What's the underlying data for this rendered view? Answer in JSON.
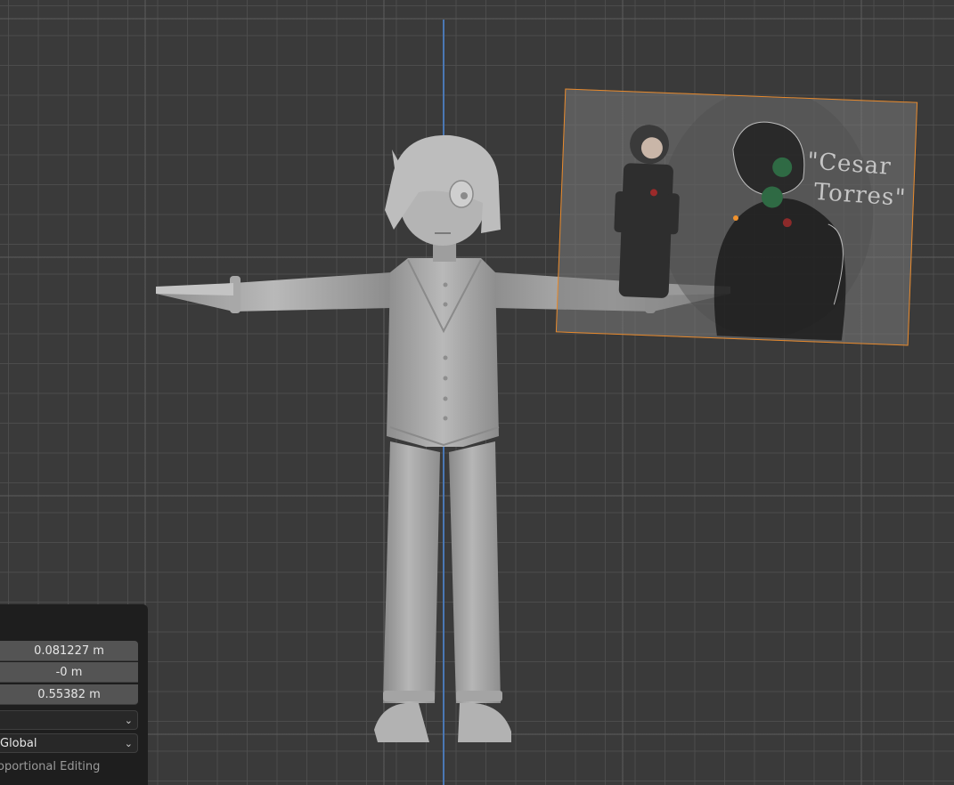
{
  "viewport": {
    "grid_color": "#4e4e4e",
    "background": "#3a3a3a",
    "z_axis_color": "#4a77b4",
    "selection_color": "#e8892b"
  },
  "reference_image": {
    "caption_line1": "\"Cesar",
    "caption_line2": "Torres\""
  },
  "operator_panel": {
    "move_x": "0.081227 m",
    "move_y": "-0 m",
    "move_z": "0.55382 m",
    "dropdown_1_value": "",
    "orientation_value": "Global",
    "proportional_editing_label": "oportional Editing"
  }
}
